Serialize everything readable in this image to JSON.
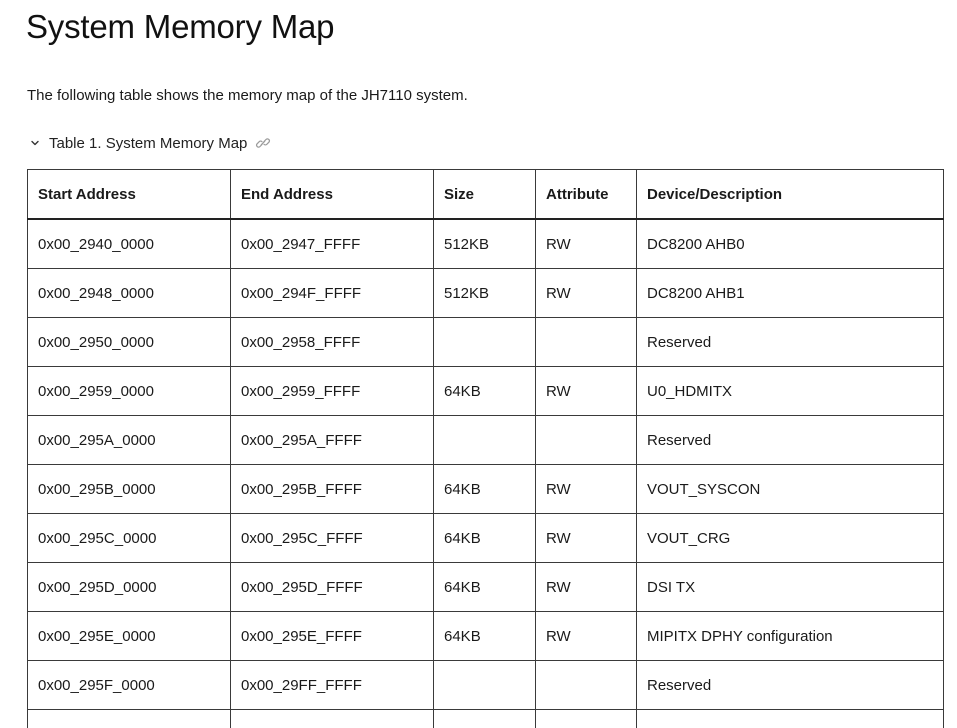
{
  "page": {
    "title": "System Memory Map",
    "intro": "The following table shows the memory map of the JH7110 system.",
    "caption": "Table 1. System Memory Map",
    "caption_icon": "chevron-down-icon",
    "link_icon": "link-icon"
  },
  "table": {
    "headers": [
      "Start Address",
      "End Address",
      "Size",
      "Attribute",
      "Device/Description"
    ],
    "rows": [
      [
        "0x00_2940_0000",
        "0x00_2947_FFFF",
        "512KB",
        "RW",
        "DC8200 AHB0"
      ],
      [
        "0x00_2948_0000",
        "0x00_294F_FFFF",
        "512KB",
        "RW",
        "DC8200 AHB1"
      ],
      [
        "0x00_2950_0000",
        "0x00_2958_FFFF",
        "",
        "",
        "Reserved"
      ],
      [
        "0x00_2959_0000",
        "0x00_2959_FFFF",
        "64KB",
        "RW",
        "U0_HDMITX"
      ],
      [
        "0x00_295A_0000",
        "0x00_295A_FFFF",
        "",
        "",
        "Reserved"
      ],
      [
        "0x00_295B_0000",
        "0x00_295B_FFFF",
        "64KB",
        "RW",
        "VOUT_SYSCON"
      ],
      [
        "0x00_295C_0000",
        "0x00_295C_FFFF",
        "64KB",
        "RW",
        "VOUT_CRG"
      ],
      [
        "0x00_295D_0000",
        "0x00_295D_FFFF",
        "64KB",
        "RW",
        "DSI TX"
      ],
      [
        "0x00_295E_0000",
        "0x00_295E_FFFF",
        "64KB",
        "RW",
        "MIPITX DPHY configuration"
      ],
      [
        "0x00_295F_0000",
        "0x00_29FF_FFFF",
        "",
        "",
        "Reserved"
      ],
      [
        "",
        "",
        "",
        "",
        ""
      ]
    ]
  }
}
